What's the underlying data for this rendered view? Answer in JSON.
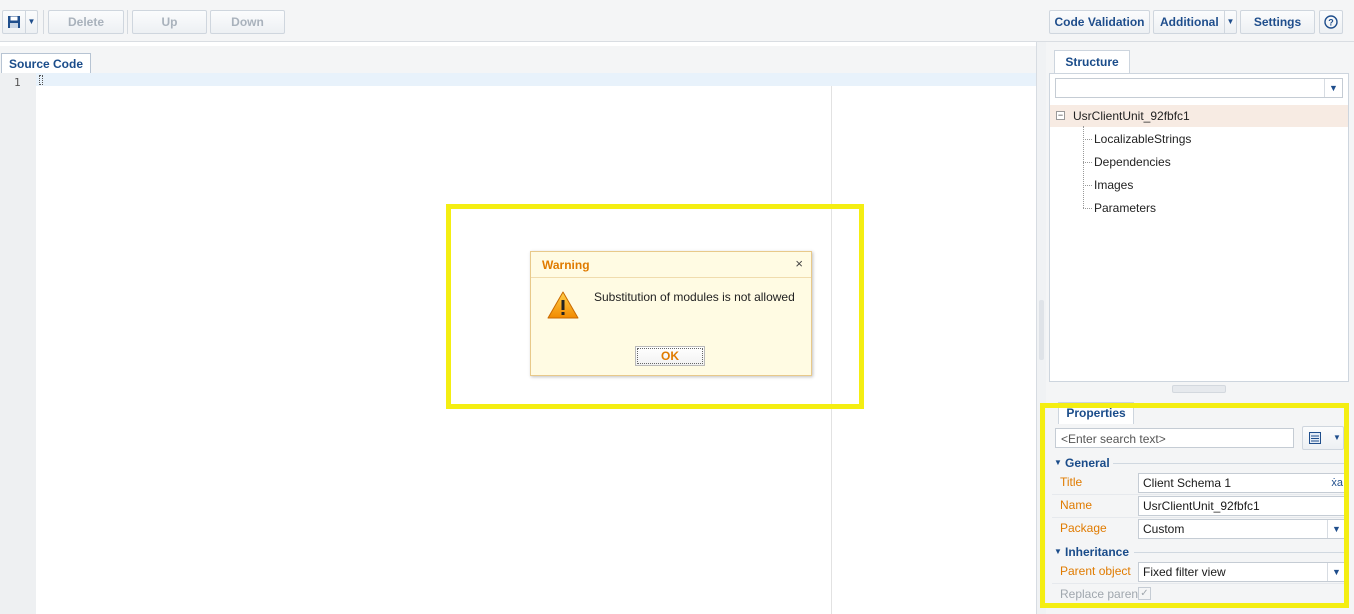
{
  "toolbar": {
    "delete_label": "Delete",
    "up_label": "Up",
    "down_label": "Down",
    "code_validation_label": "Code Validation",
    "additional_label": "Additional",
    "settings_label": "Settings"
  },
  "editor": {
    "tab_label": "Source Code",
    "line_numbers": [
      "1"
    ]
  },
  "dialog": {
    "title": "Warning",
    "close_glyph": "×",
    "message": "Substitution of modules is not allowed",
    "ok_label": "OK",
    "icon": "warning-icon"
  },
  "structure": {
    "tab_label": "Structure",
    "filter_value": "",
    "root": "UsrClientUnit_92fbfc1",
    "children": [
      "LocalizableStrings",
      "Dependencies",
      "Images",
      "Parameters"
    ]
  },
  "properties": {
    "tab_label": "Properties",
    "search_placeholder": "<Enter search text>",
    "groups": [
      {
        "name": "General",
        "rows": [
          {
            "label": "Title",
            "value": "Client Schema 1"
          },
          {
            "label": "Name",
            "value": "UsrClientUnit_92fbfc1"
          },
          {
            "label": "Package",
            "value": "Custom"
          }
        ]
      },
      {
        "name": "Inheritance",
        "rows": [
          {
            "label": "Parent object",
            "value": "Fixed filter view"
          },
          {
            "label": "Replace parent",
            "value": ""
          }
        ]
      }
    ],
    "replace_parent_checked": true
  },
  "colors": {
    "highlight": "#f4ee12",
    "accent_orange": "#e07b00",
    "link_blue": "#1a4c8a"
  }
}
